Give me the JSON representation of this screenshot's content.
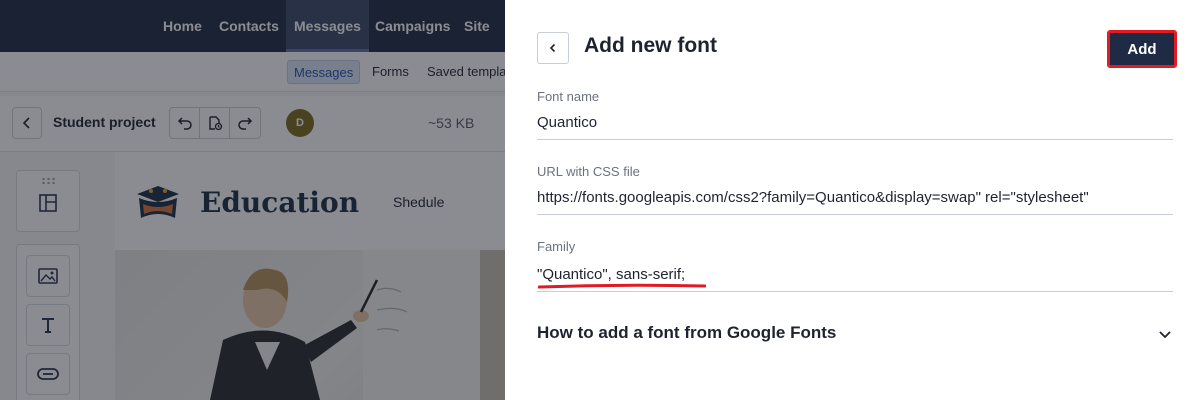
{
  "app": {
    "topnav": [
      {
        "label": "Home",
        "active": false
      },
      {
        "label": "Contacts",
        "active": false
      },
      {
        "label": "Messages",
        "active": true
      },
      {
        "label": "Campaigns",
        "active": false
      },
      {
        "label": "Site",
        "active": false
      }
    ],
    "subnav": [
      {
        "label": "Messages",
        "active": true
      },
      {
        "label": "Forms",
        "active": false
      },
      {
        "label": "Saved templa",
        "active": false
      }
    ],
    "toolbar": {
      "project_name": "Student project",
      "avatar_initial": "D",
      "size": "~53 KB"
    },
    "canvas": {
      "brand_title": "Education",
      "nav_item": "Shedule"
    },
    "icons": {
      "back": "chevron-left-icon",
      "undo": "undo-icon",
      "history": "file-history-icon",
      "redo": "redo-icon",
      "blocks": "layout-blocks-icon",
      "image": "image-icon",
      "text": "text-icon",
      "button": "button-icon"
    }
  },
  "panel": {
    "title": "Add new font",
    "add_label": "Add",
    "fields": {
      "font_name": {
        "label": "Font name",
        "value": "Quantico"
      },
      "css_url": {
        "label": "URL with CSS file",
        "value": "https://fonts.googleapis.com/css2?family=Quantico&display=swap\" rel=\"stylesheet\""
      },
      "family": {
        "label": "Family",
        "value": "\"Quantico\", sans-serif;"
      }
    },
    "accordion": {
      "title": "How to add a font from Google Fonts"
    }
  },
  "colors": {
    "nav_bg": "#1f2a44",
    "highlight": "#e01b24",
    "accent": "#2750b8"
  }
}
